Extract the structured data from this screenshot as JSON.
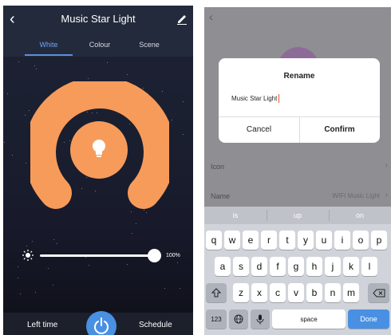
{
  "left": {
    "title": "Music Star Light",
    "tabs": [
      "White",
      "Colour",
      "Scene"
    ],
    "active_tab": "White",
    "brightness": {
      "percent": 100,
      "label": "100%"
    },
    "footer": {
      "left_time": "Left time",
      "schedule": "Schedule"
    },
    "colors": {
      "accent": "#f79b5a",
      "primary": "#4a90e2",
      "background": "#1b2031"
    },
    "icons": [
      "back-icon",
      "edit-icon",
      "bulb-icon",
      "sun-icon",
      "power-icon"
    ]
  },
  "right": {
    "rows": [
      {
        "label": "Icon",
        "value": ""
      },
      {
        "label": "Name",
        "value": "WIFI Music Light"
      }
    ],
    "dialog": {
      "title": "Rename",
      "input_value": "Music Star Light",
      "cancel_label": "Cancel",
      "confirm_label": "Confirm"
    },
    "keyboard": {
      "suggestions": [
        "is",
        "up",
        "on"
      ],
      "row1": [
        "q",
        "w",
        "e",
        "r",
        "t",
        "y",
        "u",
        "i",
        "o",
        "p"
      ],
      "row2": [
        "a",
        "s",
        "d",
        "f",
        "g",
        "h",
        "j",
        "k",
        "l"
      ],
      "row3": [
        "z",
        "x",
        "c",
        "v",
        "b",
        "n",
        "m"
      ],
      "numbers_label": "123",
      "space_label": "space",
      "done_label": "Done"
    },
    "icons": [
      "back-icon",
      "shift-icon",
      "backspace-icon",
      "globe-icon",
      "microphone-icon"
    ]
  }
}
